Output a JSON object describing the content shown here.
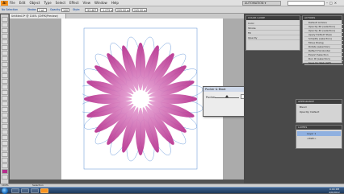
{
  "app": {
    "logo": "Ai"
  },
  "menu": [
    "File",
    "Edit",
    "Object",
    "Type",
    "Select",
    "Effect",
    "View",
    "Window",
    "Help"
  ],
  "workspace": "AUTOMATION ▾",
  "control_bar": {
    "label": "No Selection",
    "stroke_label": "Stroke:",
    "stroke_value": "1 pt",
    "opacity_label": "Opacity:",
    "opacity_value": "100",
    "style_label": "Style:",
    "x_value": "-93.487 px",
    "y_value": "-1.079 pt",
    "w_value": "205.00 px",
    "h_value": "245.00 px"
  },
  "doc_tab": "Untitled-5* @ 104% (CMYK/Preview)",
  "dialog": {
    "title": "Pucker & Bloat",
    "label": "Pucker",
    "value": "-61",
    "unit": "%",
    "bloat": "Bloat",
    "ok": "OK",
    "cancel": "Cancel",
    "preview": "Preview",
    "preview_check": "✓"
  },
  "panels": {
    "swatches_title": "COLOR GUIDE",
    "swatch_rows": [
      "Color",
      "Stroke",
      "Fill",
      "Opacity"
    ],
    "actions_title": "ACTIONS",
    "actions": [
      "Default Actions",
      "Opacity 60 (selection)",
      "Opacity 40 (selection)",
      "Apply Default Style",
      "Simplify (selection)",
      "Move Dialog",
      "Rotate (selection)",
      "Reflect Horizontal",
      "Export Selection",
      "Run ID (selection)",
      "Save for Web (GIF)"
    ],
    "appearance_title": "APPEARANCE",
    "appearance_rows": [
      "Blend",
      "Opacity: Default"
    ],
    "layers_title": "LAYERS",
    "layers": [
      "Layer 1",
      "<Path>"
    ]
  },
  "status": {
    "zoom": "104%",
    "tool": "Selection"
  },
  "taskbar": {
    "time": "0:00 PM",
    "date": "2/6/2012"
  },
  "flower": {
    "petals": 20,
    "colors": {
      "outer": "#b62d8c",
      "inner": "#e6a2d4",
      "center": "#ffffff",
      "guides": "#5a8fd6"
    }
  }
}
